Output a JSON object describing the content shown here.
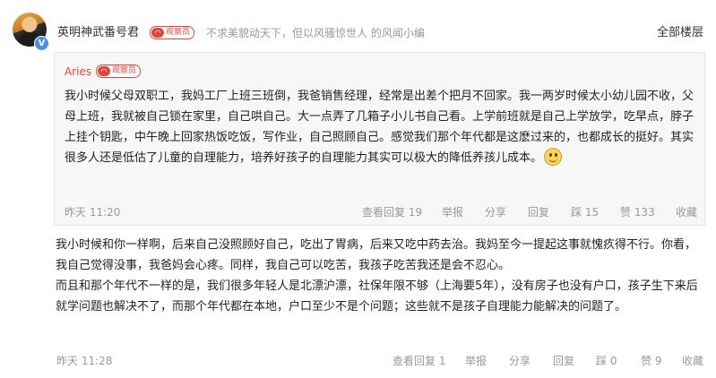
{
  "header": {
    "username": "英明神武番号君",
    "observer_badge": "观察员",
    "signature": "不求美貌动天下，但以风骚惊世人 的风闻小编",
    "all_floors": "全部楼层",
    "verified_badge": "V"
  },
  "quote": {
    "author": "Aries",
    "observer_badge": "观察员",
    "text": "我小时候父母双职工，我妈工厂上班三班倒，我爸销售经理，经常是出差个把月不回家。我一两岁时候太小幼儿园不收，父母上班，我就被自己锁在家里，自己哄自己。大一点弄了几箱子小儿书自己看。上学前班就是自己上学放学，吃早点，脖子上挂个钥匙，中午晚上回家热饭吃饭，写作业，自己照顾自己。感觉我们那个年代都是这麽过来的，也都成长的挺好。其实很多人还是低估了儿童的自理能力，培养好孩子的自理能力其实可以极大的降低养孩儿成本。",
    "emoji": "smile-emoji",
    "time": "昨天 11:20",
    "actions": {
      "view_replies": "查看回复 19",
      "report": "举报",
      "share": "分享",
      "reply": "回复",
      "dislike": "踩 15",
      "like": "赞 133",
      "collect": "收藏"
    }
  },
  "reply": {
    "paragraphs": [
      "我小时候和你一样啊，后来自己没照顾好自己，吃出了胃病，后来又吃中药去治。我妈至今一提起这事就愧疚得不行。你看，我自己觉得没事，我爸妈会心疼。同样，我自己可以吃苦，我孩子吃苦我还是会不忍心。",
      "而且和那个年代不一样的是，我们很多年轻人是北漂沪漂，社保年限不够（上海要5年），没有房子也没有户口，孩子生下来后就学问题也解决不了，而那个年代都在本地，户口至少不是个问题；这些就不是孩子自理能力能解决的问题了。"
    ],
    "time": "昨天 11:28",
    "actions": {
      "view_replies": "查看回复 1",
      "report": "举报",
      "share": "分享",
      "reply": "回复",
      "dislike": "踩 0",
      "like": "赞 9",
      "collect": "收藏"
    }
  },
  "colors": {
    "accent_red": "#e2463b",
    "meta_gray": "#999999",
    "quote_bg": "#f7f7f7",
    "verified_blue": "#4a90e2"
  }
}
